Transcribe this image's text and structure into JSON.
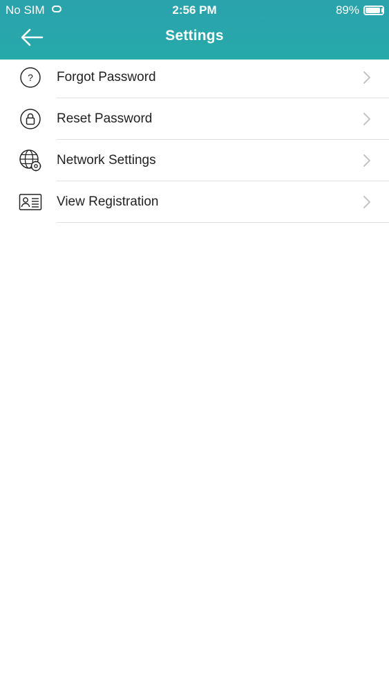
{
  "status_bar": {
    "carrier": "No SIM",
    "time": "2:56 PM",
    "battery_percent": "89%",
    "battery_level": 0.89
  },
  "nav": {
    "title": "Settings",
    "back_icon": "back-arrow-icon"
  },
  "colors": {
    "header": "#27a7ab",
    "text": "#222222",
    "divider": "#e2e2e2",
    "chevron": "#c4c4c4"
  },
  "menu": {
    "items": [
      {
        "label": "Forgot Password",
        "icon": "question-circle-icon"
      },
      {
        "label": "Reset Password",
        "icon": "lock-circle-icon"
      },
      {
        "label": "Network Settings",
        "icon": "globe-gear-icon"
      },
      {
        "label": "View Registration",
        "icon": "id-card-icon"
      }
    ]
  }
}
